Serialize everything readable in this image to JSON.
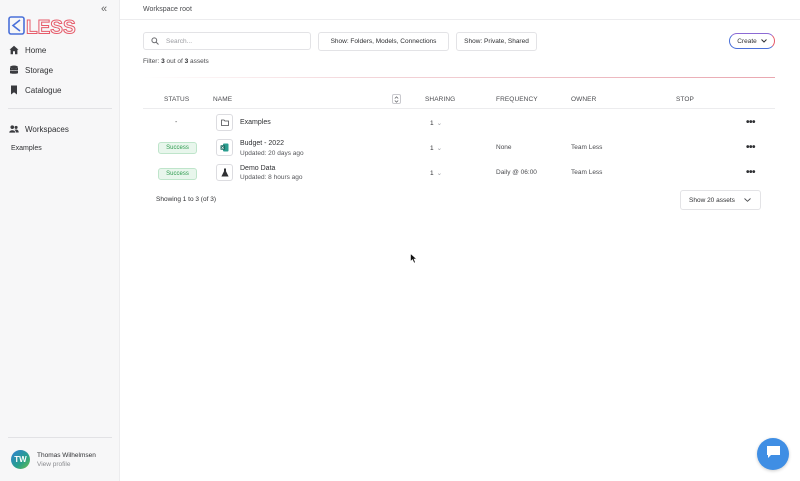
{
  "sidebar": {
    "logo_text": "LESS",
    "collapse_glyph": "«",
    "nav": [
      {
        "label": "Home",
        "icon": "home-icon"
      },
      {
        "label": "Storage",
        "icon": "database-icon"
      },
      {
        "label": "Catalogue",
        "icon": "bookmark-icon"
      }
    ],
    "workspaces": {
      "label": "Workspaces",
      "icon": "users-icon",
      "items": [
        "Examples"
      ]
    },
    "user": {
      "initials": "TW",
      "name": "Thomas Wilhelmsen",
      "link": "View profile"
    }
  },
  "header": {
    "breadcrumb": "Workspace root"
  },
  "toolbar": {
    "search_placeholder": "Search...",
    "filter_types": "Show: Folders, Models, Connections",
    "filter_visibility": "Show: Private, Shared",
    "create_label": "Create"
  },
  "filter": {
    "prefix": "Filter:",
    "shown": "3",
    "middle": "out of",
    "total": "3",
    "suffix": "assets"
  },
  "table": {
    "headers": [
      "STATUS",
      "NAME",
      "SHARING",
      "FREQUENCY",
      "OWNER",
      "STOP"
    ],
    "rows": [
      {
        "status": "-",
        "name": "Examples",
        "updated": "",
        "sharing": "1",
        "frequency": "",
        "owner": "",
        "icon": "folder-icon"
      },
      {
        "status": "Success",
        "name": "Budget - 2022",
        "updated": "Updated: 20 days ago",
        "sharing": "1",
        "frequency": "None",
        "owner": "Team Less",
        "icon": "spreadsheet-icon"
      },
      {
        "status": "Success",
        "name": "Demo Data",
        "updated": "Updated: 8 hours ago",
        "sharing": "1",
        "frequency": "Daily @ 06:00",
        "owner": "Team Less",
        "icon": "flask-icon"
      }
    ]
  },
  "footer": {
    "showing": "Showing 1 to 3 (of 3)",
    "page_size": "Show 20 assets"
  },
  "colors": {
    "accent": "#4a70d9",
    "success": "#2c9a4d",
    "chat": "#3f8ee4",
    "logo_red": "#e65b6a"
  }
}
